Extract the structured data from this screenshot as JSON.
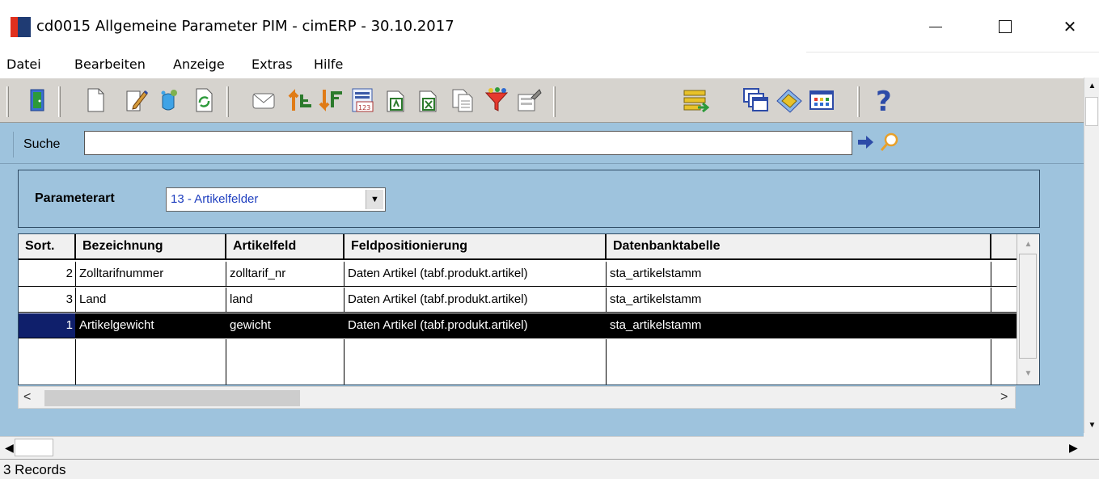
{
  "window": {
    "title": "cd0015 Allgemeine Parameter PIM - cimERP - 30.10.2017",
    "minimize": "—",
    "maximize": "☐",
    "close": "✕"
  },
  "menu": [
    "Datei",
    "Bearbeiten",
    "Anzeige",
    "Extras",
    "Hilfe"
  ],
  "toolbar": {
    "buttons": [
      {
        "name": "exit-icon"
      },
      {
        "name": "new-document-icon"
      },
      {
        "name": "edit-icon"
      },
      {
        "name": "copy-record-icon"
      },
      {
        "name": "refresh-icon"
      },
      {
        "name": "mail-icon"
      },
      {
        "name": "sort-ascending-icon"
      },
      {
        "name": "sort-descending-icon"
      },
      {
        "name": "number-format-icon"
      },
      {
        "name": "export-icon"
      },
      {
        "name": "excel-export-icon"
      },
      {
        "name": "copy-icon"
      },
      {
        "name": "filter-icon"
      },
      {
        "name": "settings-icon"
      },
      {
        "name": "layout-icon"
      },
      {
        "name": "windows-icon"
      },
      {
        "name": "library-icon"
      },
      {
        "name": "grid-config-icon"
      },
      {
        "name": "help-icon"
      }
    ]
  },
  "search": {
    "label": "Suche",
    "value": "",
    "placeholder": ""
  },
  "parameter": {
    "label": "Parameterart",
    "selected": "13 - Artikelfelder"
  },
  "grid": {
    "columns": [
      "Sort.",
      "Bezeichnung",
      "Artikelfeld",
      "Feldpositionierung",
      "Datenbanktabelle"
    ],
    "rows": [
      {
        "sort": "2",
        "bezeichnung": "Zolltarifnummer",
        "artikelfeld": "zolltarif_nr",
        "feldpositionierung": "Daten Artikel (tabf.produkt.artikel)",
        "datenbanktabelle": "sta_artikelstamm",
        "selected": false
      },
      {
        "sort": "3",
        "bezeichnung": "Land",
        "artikelfeld": "land",
        "feldpositionierung": "Daten Artikel (tabf.produkt.artikel)",
        "datenbanktabelle": "sta_artikelstamm",
        "selected": false
      },
      {
        "sort": "1",
        "bezeichnung": "Artikelgewicht",
        "artikelfeld": "gewicht",
        "feldpositionierung": "Daten Artikel (tabf.produkt.artikel)",
        "datenbanktabelle": "sta_artikelstamm",
        "selected": true
      }
    ]
  },
  "status": {
    "text": "3 Records"
  },
  "colors": {
    "accent_blue": "#9ec3dd",
    "selection": "#000000",
    "toolbar": "#d6d3ce"
  }
}
